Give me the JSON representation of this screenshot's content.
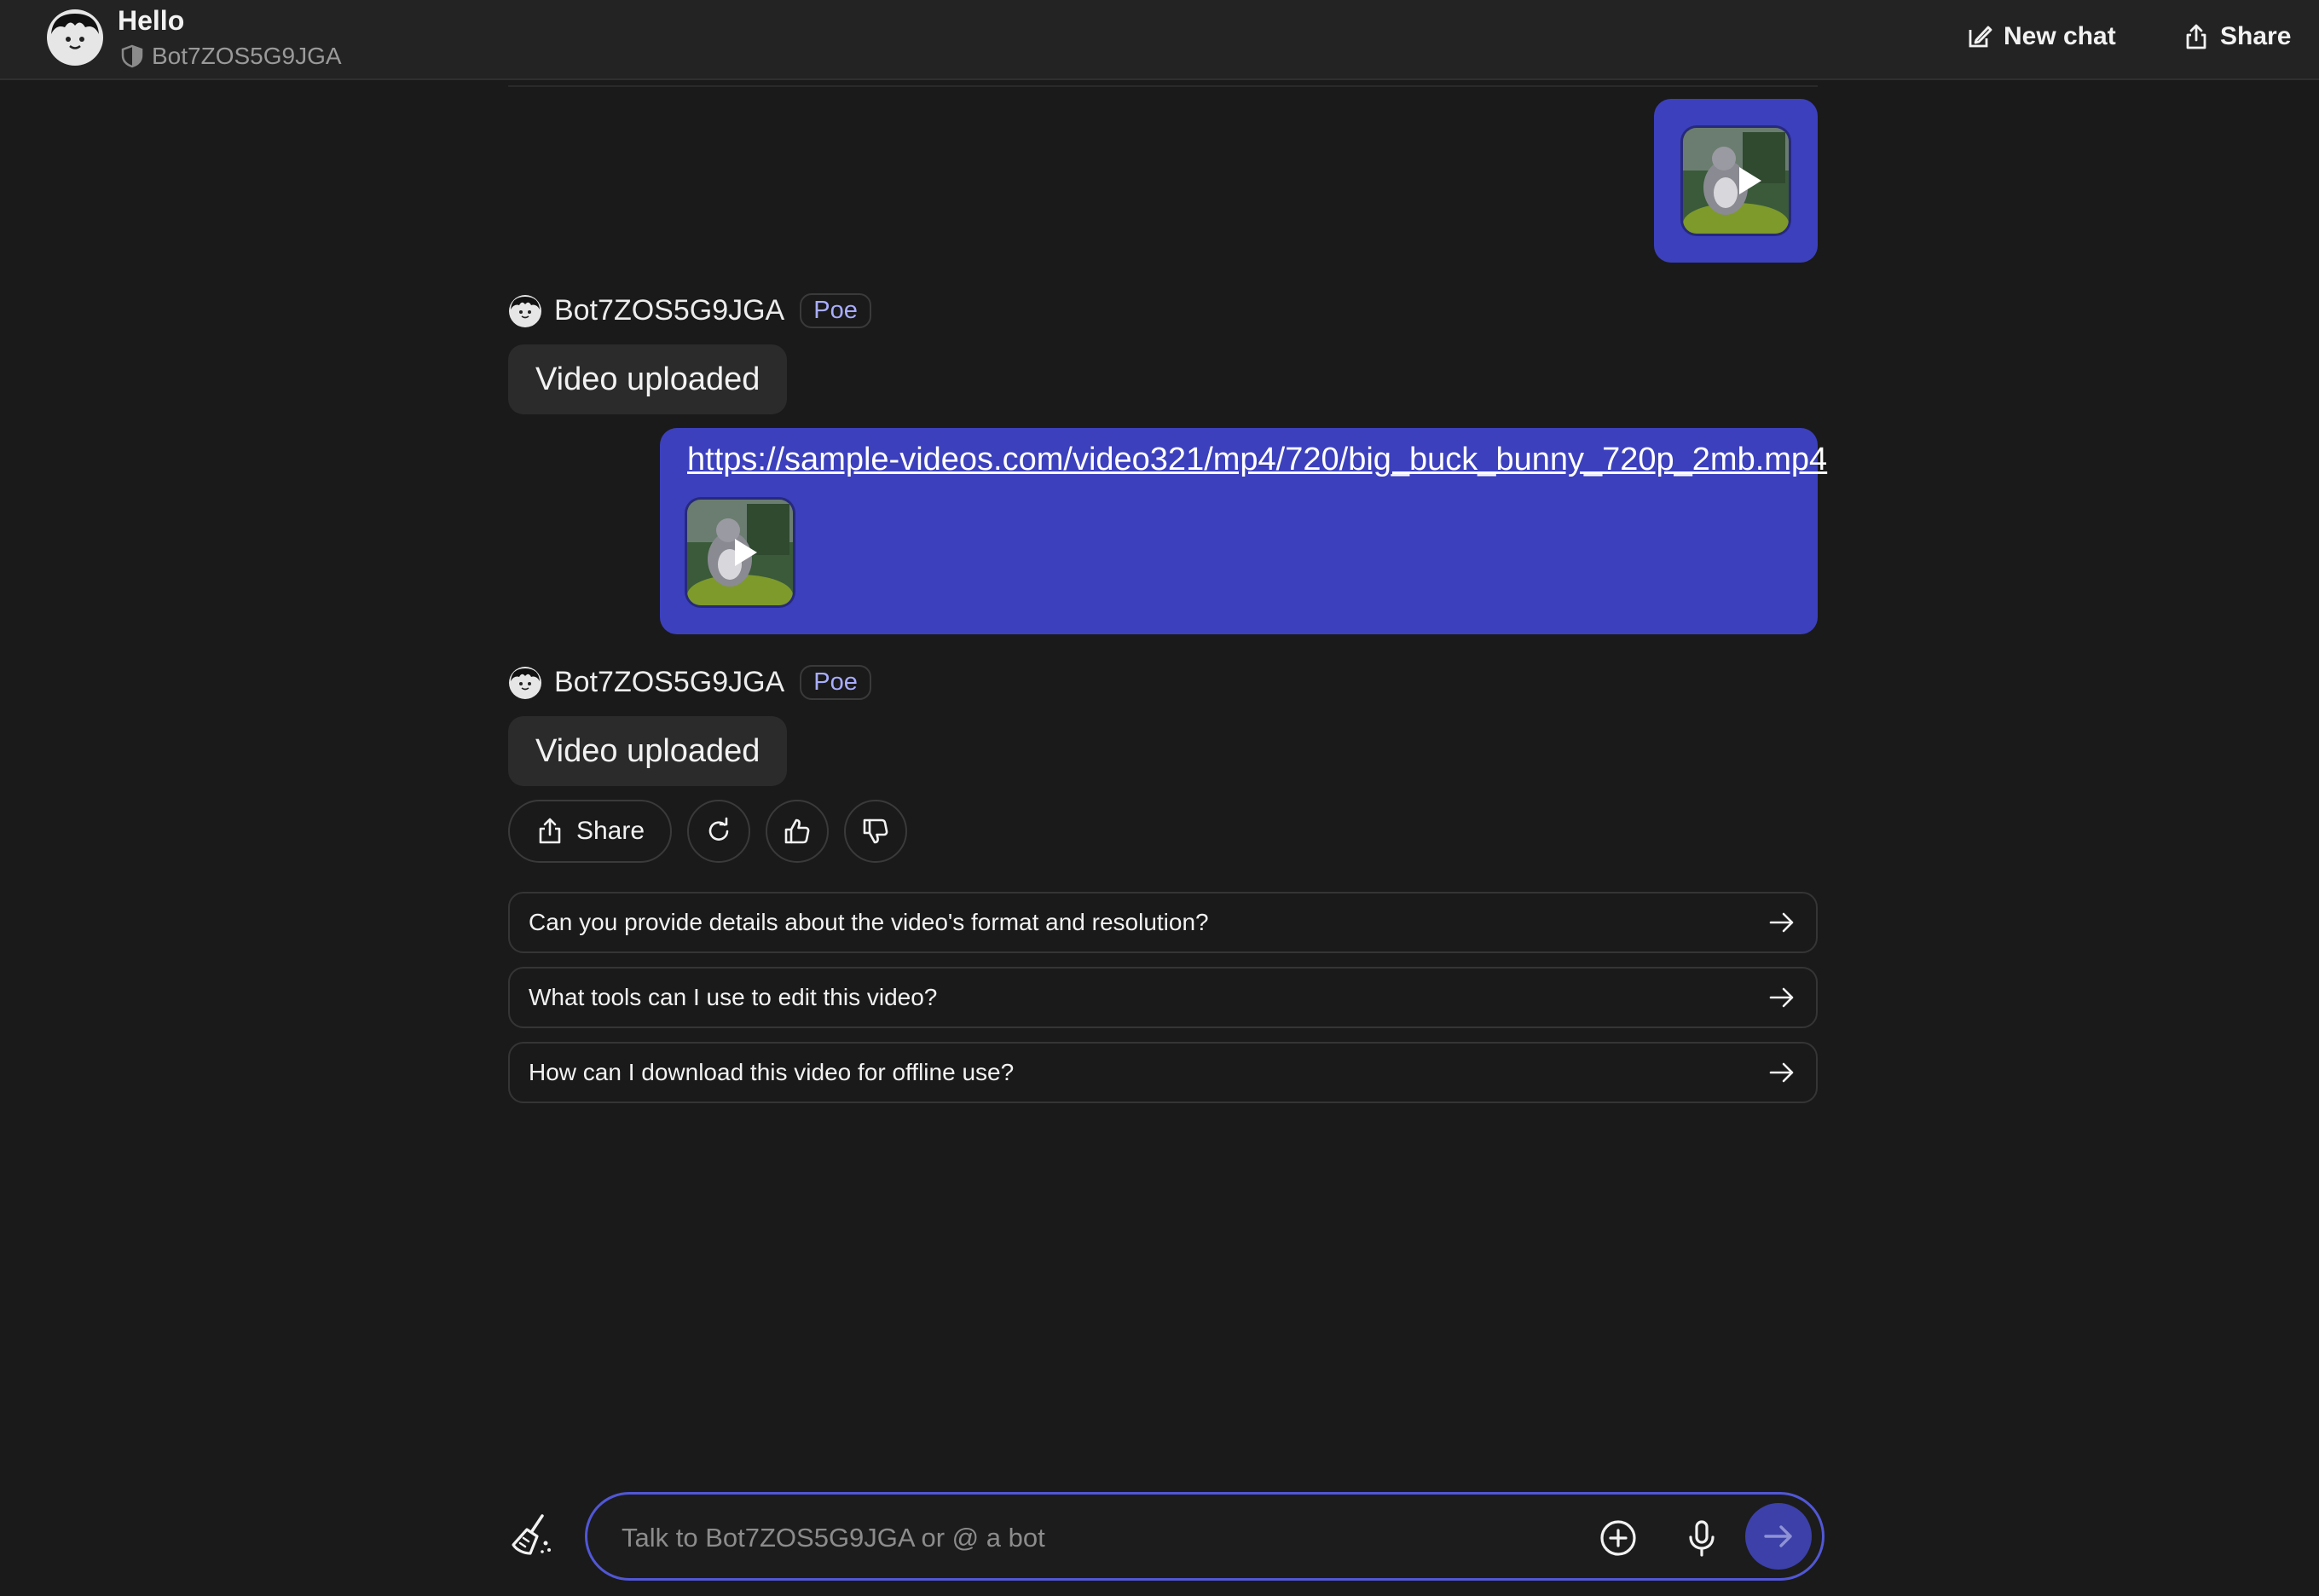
{
  "header": {
    "title": "Hello",
    "bot_name": "Bot7ZOS5G9JGA",
    "new_chat_label": "New chat",
    "share_label": "Share"
  },
  "messages": {
    "user_video_1": {
      "thumbnail": "big-buck-bunny-thumbnail"
    },
    "bot_1": {
      "name": "Bot7ZOS5G9JGA",
      "badge": "Poe",
      "text": "Video uploaded"
    },
    "user_link": {
      "url": "https://sample-videos.com/video321/mp4/720/big_buck_bunny_720p_2mb.mp4",
      "thumbnail": "big-buck-bunny-thumbnail"
    },
    "bot_2": {
      "name": "Bot7ZOS5G9JGA",
      "badge": "Poe",
      "text": "Video uploaded"
    }
  },
  "actions": {
    "share_label": "Share"
  },
  "suggestions": [
    "Can you provide details about the video's format and resolution?",
    "What tools can I use to edit this video?",
    "How can I download this video for offline use?"
  ],
  "composer": {
    "placeholder": "Talk to Bot7ZOS5G9JGA or @ a bot"
  },
  "colors": {
    "background": "#1a1a1a",
    "user_bubble": "#3c40bd",
    "accent": "#5157d6",
    "badge_text": "#a9adff"
  }
}
